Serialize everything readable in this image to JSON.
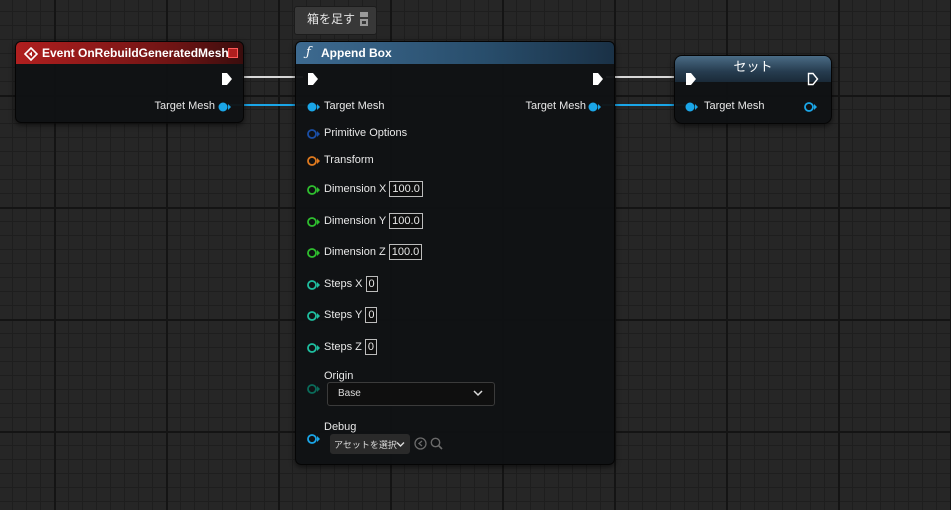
{
  "tooltip": {
    "label": "箱を足す",
    "icon": "save-disk-icon"
  },
  "event_node": {
    "title": "Event OnRebuildGeneratedMesh",
    "icon": "event-diamond-icon",
    "delegate_icon": "delegate-square-icon",
    "pins": {
      "target_mesh": "Target Mesh"
    }
  },
  "append_box_node": {
    "title": "Append Box",
    "icon": "function-f-icon",
    "inputs": {
      "target_mesh": "Target Mesh",
      "primitive_options": "Primitive Options",
      "transform": "Transform",
      "dimension_x": {
        "label": "Dimension X",
        "value": "100.0"
      },
      "dimension_y": {
        "label": "Dimension Y",
        "value": "100.0"
      },
      "dimension_z": {
        "label": "Dimension Z",
        "value": "100.0"
      },
      "steps_x": {
        "label": "Steps X",
        "value": "0"
      },
      "steps_y": {
        "label": "Steps Y",
        "value": "0"
      },
      "steps_z": {
        "label": "Steps Z",
        "value": "0"
      },
      "origin": {
        "label": "Origin",
        "selected": "Base"
      },
      "debug": {
        "label": "Debug",
        "asset_select": "アセットを選択"
      }
    },
    "outputs": {
      "target_mesh": "Target Mesh"
    }
  },
  "set_node": {
    "title": "セット",
    "pins": {
      "target_mesh": "Target Mesh"
    }
  },
  "colors": {
    "exec": "#ffffff",
    "object_pin": "#1aa6e8",
    "struct_options": "#1a4fa8",
    "transform": "#e07a1f",
    "float": "#2fbf2f",
    "integer": "#1fbfa0",
    "enum": "#0a6b5a"
  }
}
